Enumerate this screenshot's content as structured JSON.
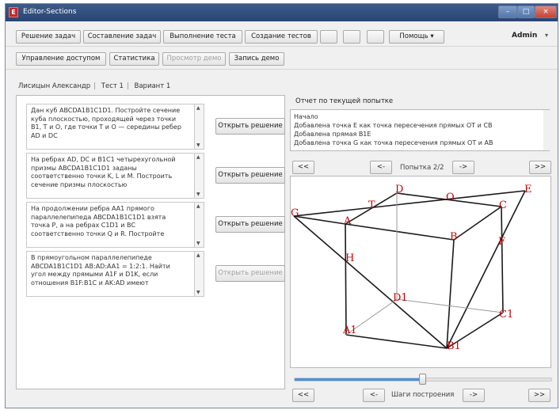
{
  "window": {
    "title": "Editor-Sections",
    "icon_text": "E",
    "controls": {
      "minimize": "–",
      "maximize": "□",
      "close": "×"
    }
  },
  "toolbar1": {
    "buttons": [
      "Решение задач",
      "Составление задач",
      "Выполнение теста",
      "Создание тестов",
      "",
      "",
      "",
      "Помощь ▾"
    ],
    "user": "Admin",
    "user_arrow": "▾"
  },
  "toolbar2": {
    "buttons": [
      "Управление доступом",
      "Статистика",
      "Просмотр демо",
      "Запись демо"
    ]
  },
  "breadcrumb": [
    "Лисицын Александр",
    "Тест 1",
    "Вариант 1"
  ],
  "tasks": [
    {
      "text": "Дан куб ABCDA1B1C1D1. Постройте сечение куба плоскостью, проходящей через точки B1, T и O, где точки T и O — середины ребер AD и DC",
      "button": "Открыть решение",
      "enabled": true
    },
    {
      "text": "На ребрах AD, DC и B1C1 четырехугольной призмы ABCDA1B1C1D1 заданы соответственно точки K, L и M. Построить сечение призмы плоскостью",
      "button": "Открыть решение",
      "enabled": true
    },
    {
      "text": "На продолжении ребра AA1 прямого параллелепипеда ABCDA1B1C1D1 взята точка P, а на ребрах C1D1 и BC соответственно точки Q и R. Постройте",
      "button": "Открыть решение",
      "enabled": true
    },
    {
      "text": "В прямоугольном параллелепипеде ABCDA1B1C1D1 AB:AD:AA1 = 1:2:1. Найти угол между прямыми A1F и D1K, если отношения B1F:B1C и AK:AD имеют",
      "button": "Открыть решение",
      "enabled": false
    }
  ],
  "report": {
    "label": "Отчет по текущей попытке",
    "lines": [
      "Начало",
      "Добавлена точка E как точка пересечения прямых OT и CB",
      "Добавлена прямая B1E",
      "Добавлена точка G как точка пересечения прямых OT и AB"
    ]
  },
  "attempt_nav": {
    "first": "<<",
    "prev": "<-",
    "label": "Попытка 2/2",
    "next": "->",
    "last": ">>"
  },
  "steps_nav": {
    "first": "<<",
    "prev": "<-",
    "label": "Шаги построения",
    "next": "->",
    "last": ">>"
  },
  "steps_progress": 0.5,
  "figure": {
    "points": {
      "G": "G",
      "A": "A",
      "T": "T",
      "D": "D",
      "O": "O",
      "C": "C",
      "E": "E",
      "B": "B",
      "F": "F",
      "H": "H",
      "D1": "D1",
      "A1": "A1",
      "C1": "C1",
      "B1": "B1"
    }
  },
  "colors": {
    "title_bar": "#2f4d7e",
    "figure_label": "#cc0000",
    "slider": "#4a90d9"
  }
}
